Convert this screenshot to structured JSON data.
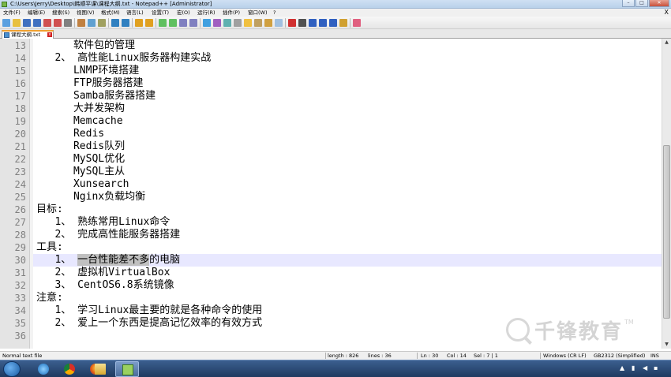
{
  "window": {
    "title": "C:\\Users\\Jerry\\Desktop\\韩顺平课\\课程大纲.txt - Notepad++ [Administrator]",
    "minimize": "–",
    "maximize": "□",
    "close": "✕"
  },
  "menu": {
    "items": [
      "文件(F)",
      "编辑(E)",
      "搜索(S)",
      "视图(V)",
      "格式(M)",
      "语言(L)",
      "设置(T)",
      "宏(O)",
      "运行(R)",
      "插件(P)",
      "窗口(W)",
      "?"
    ],
    "close_doc": "X"
  },
  "toolbar": {
    "icons": [
      "new-file-icon",
      "open-file-icon",
      "save-icon",
      "save-all-icon",
      "close-icon",
      "close-all-icon",
      "print-icon",
      "cut-icon",
      "copy-icon",
      "paste-icon",
      "undo-icon",
      "redo-icon",
      "find-icon",
      "replace-icon",
      "zoom-in-icon",
      "zoom-out-icon",
      "sync-v-icon",
      "sync-h-icon",
      "word-wrap-icon",
      "all-chars-icon",
      "indent-guide-icon",
      "lang-icon",
      "doc-map-icon",
      "func-list-icon",
      "folder-workspace-icon",
      "monitor-icon",
      "record-icon",
      "stop-icon",
      "play-icon",
      "play-multiple-icon",
      "save-macro-icon",
      "spellcheck-icon",
      "plugin-icon"
    ]
  },
  "tab": {
    "label": "课程大纲.txt",
    "close": "x"
  },
  "editor": {
    "current_line": 30,
    "lines": [
      {
        "n": "13",
        "text": "      软件包的管理"
      },
      {
        "n": "14",
        "text": "   2、 高性能Linux服务器构建实战"
      },
      {
        "n": "15",
        "text": "      LNMP环境搭建"
      },
      {
        "n": "16",
        "text": "      FTP服务器搭建"
      },
      {
        "n": "17",
        "text": "      Samba服务器搭建"
      },
      {
        "n": "18",
        "text": "      大并发架构"
      },
      {
        "n": "19",
        "text": "      Memcache"
      },
      {
        "n": "20",
        "text": "      Redis"
      },
      {
        "n": "21",
        "text": "      Redis队列"
      },
      {
        "n": "22",
        "text": "      MySQL优化"
      },
      {
        "n": "23",
        "text": "      MySQL主从"
      },
      {
        "n": "24",
        "text": "      Xunsearch"
      },
      {
        "n": "25",
        "text": "      Nginx负载均衡"
      },
      {
        "n": "26",
        "text": "目标:"
      },
      {
        "n": "27",
        "text": "   1、 熟练常用Linux命令"
      },
      {
        "n": "28",
        "text": "   2、 完成高性能服务器搭建"
      },
      {
        "n": "29",
        "text": "工具:"
      },
      {
        "n": "30",
        "pre": "   1、 ",
        "selected": "一台性能差不多",
        "post": "的电脑"
      },
      {
        "n": "31",
        "text": "   2、 虚拟机VirtualBox"
      },
      {
        "n": "32",
        "text": "   3、 CentOS6.8系统镜像"
      },
      {
        "n": "33",
        "text": "注意:"
      },
      {
        "n": "34",
        "text": "   1、 学习Linux最主要的就是各种命令的使用"
      },
      {
        "n": "35",
        "text": "   2、 爱上一个东西是提高记忆效率的有效方式"
      },
      {
        "n": "36",
        "text": ""
      }
    ]
  },
  "watermark": {
    "text": "千锋教育",
    "tm": "TM"
  },
  "status": {
    "type": "Normal text file",
    "length": "length : 826",
    "lines": "lines : 36",
    "ln": "Ln : 30",
    "col": "Col : 14",
    "sel": "Sel : 7 | 1",
    "eol": "Windows (CR LF)",
    "encoding": "GB2312 (Simplified)",
    "mode": "INS"
  },
  "taskbar": {
    "apps": [
      "ie-icon",
      "chrome-icon",
      "firefox-icon",
      "explorer-icon",
      "notepadpp-icon"
    ]
  }
}
